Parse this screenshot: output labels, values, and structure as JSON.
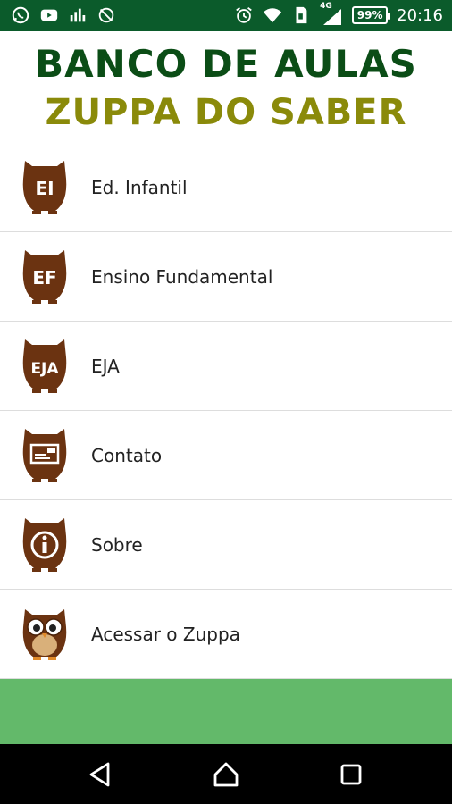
{
  "status_bar": {
    "time": "20:16",
    "battery": "99%",
    "network": "4G",
    "left_icons": [
      "whatsapp-icon",
      "youtube-icon",
      "signal-alt-icon",
      "no-signal-icon"
    ],
    "right_icons": [
      "alarm-icon",
      "wifi-icon",
      "sim-icon",
      "cell-signal-icon",
      "battery-icon"
    ]
  },
  "header": {
    "title_line1": "BANCO DE AULAS",
    "title_line2": "ZUPPA DO SABER"
  },
  "menu": {
    "items": [
      {
        "label": "Ed. Infantil",
        "icon": "owl-ei-icon",
        "icon_text": "EI"
      },
      {
        "label": "Ensino Fundamental",
        "icon": "owl-ef-icon",
        "icon_text": "EF"
      },
      {
        "label": "EJA",
        "icon": "owl-eja-icon",
        "icon_text": "EJA"
      },
      {
        "label": "Contato",
        "icon": "owl-mail-icon"
      },
      {
        "label": "Sobre",
        "icon": "owl-info-icon"
      },
      {
        "label": "Acessar o Zuppa",
        "icon": "owl-mascot-icon"
      }
    ]
  },
  "colors": {
    "status_bar": "#0b5b2b",
    "title_green": "#0b4d16",
    "title_olive": "#8a8a0a",
    "owl_brown": "#6b3311",
    "footer_green": "#63b96a",
    "nav_bar": "#000000"
  }
}
